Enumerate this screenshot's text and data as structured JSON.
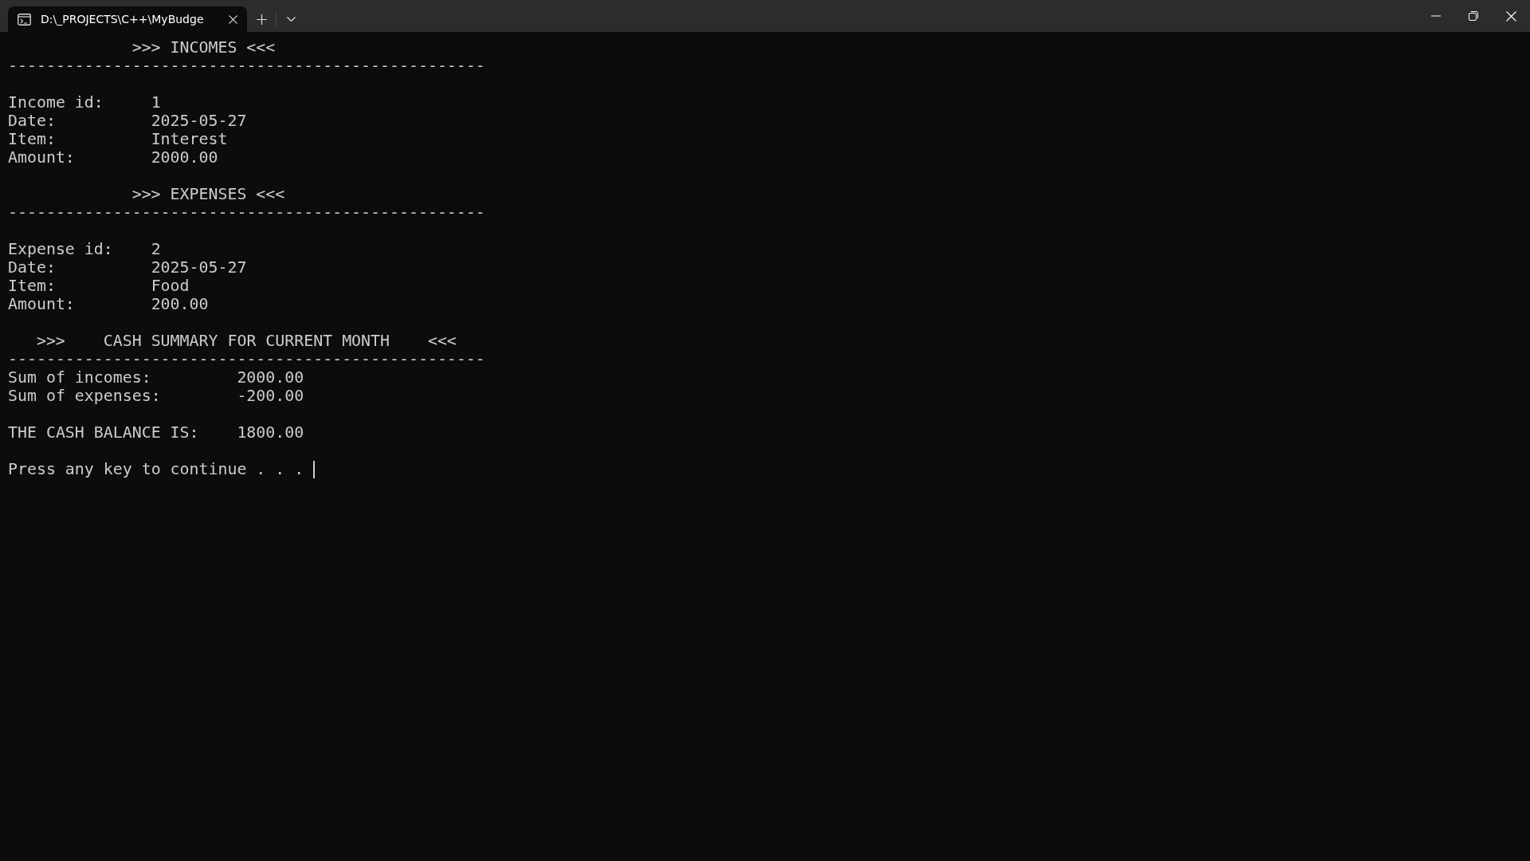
{
  "window": {
    "tabs": [
      {
        "title": "D:\\_PROJECTS\\C++\\MyBudge",
        "selected": true
      }
    ]
  },
  "terminal": {
    "lines": [
      {
        "kind": "heading",
        "parts": [
          ">>> INCOMES <<<"
        ]
      },
      {
        "kind": "rule",
        "text": "--------------------------------------------------"
      },
      {
        "kind": "blank"
      },
      {
        "kind": "field",
        "label": "Income id:",
        "value": "1"
      },
      {
        "kind": "field",
        "label": "Date:",
        "value": "2025-05-27"
      },
      {
        "kind": "field",
        "label": "Item:",
        "value": "Interest"
      },
      {
        "kind": "field",
        "label": "Amount:",
        "value": "2000.00"
      },
      {
        "kind": "blank"
      },
      {
        "kind": "heading",
        "parts": [
          ">>> EXPENSES <<<"
        ]
      },
      {
        "kind": "rule",
        "text": "--------------------------------------------------"
      },
      {
        "kind": "blank"
      },
      {
        "kind": "field",
        "label": "Expense id:",
        "value": "2"
      },
      {
        "kind": "field",
        "label": "Date:",
        "value": "2025-05-27"
      },
      {
        "kind": "field",
        "label": "Item:",
        "value": "Food"
      },
      {
        "kind": "field",
        "label": "Amount:",
        "value": "200.00"
      },
      {
        "kind": "blank"
      },
      {
        "kind": "banner",
        "parts": [
          ">>>",
          "CASH SUMMARY FOR CURRENT MONTH",
          "<<<"
        ]
      },
      {
        "kind": "rule",
        "text": "--------------------------------------------------"
      },
      {
        "kind": "summary",
        "label": "Sum of incomes:",
        "value": "2000.00"
      },
      {
        "kind": "summary",
        "label": "Sum of expenses:",
        "value": "-200.00"
      },
      {
        "kind": "blank"
      },
      {
        "kind": "summary",
        "label": "THE CASH BALANCE IS:",
        "value": "1800.00"
      },
      {
        "kind": "blank"
      },
      {
        "kind": "prompt",
        "text": "Press any key to continue . . .",
        "cursor": true
      }
    ]
  }
}
